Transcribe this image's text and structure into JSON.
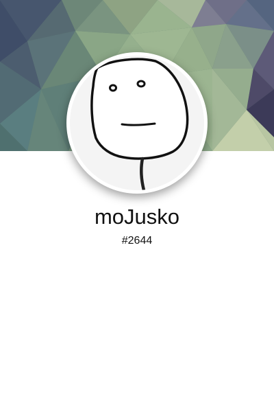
{
  "profile": {
    "username": "moJusko",
    "tag": "#2644"
  },
  "icons": {
    "avatar": "poker-face-meme-icon",
    "cover": "low-poly-banner"
  },
  "colors": {
    "background": "#ffffff",
    "text": "#111111",
    "avatar_ring": "#ffffff"
  }
}
